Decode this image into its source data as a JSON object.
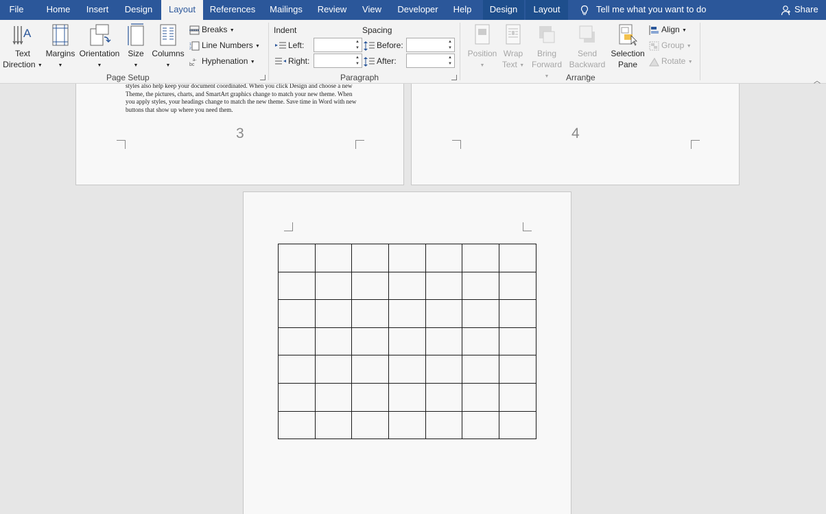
{
  "tabs": [
    {
      "label": "File",
      "active": false
    },
    {
      "label": "Home",
      "active": false
    },
    {
      "label": "Insert",
      "active": false
    },
    {
      "label": "Design",
      "active": false
    },
    {
      "label": "Layout",
      "active": true
    },
    {
      "label": "References",
      "active": false
    },
    {
      "label": "Mailings",
      "active": false
    },
    {
      "label": "Review",
      "active": false
    },
    {
      "label": "View",
      "active": false
    },
    {
      "label": "Developer",
      "active": false
    },
    {
      "label": "Help",
      "active": false
    },
    {
      "label": "Design",
      "active": false,
      "contextual": true
    },
    {
      "label": "Layout",
      "active": false,
      "contextual": true
    }
  ],
  "tell_me": "Tell me what you want to do",
  "share": "Share",
  "page_setup": {
    "text_direction": {
      "line1": "Text",
      "line2": "Direction"
    },
    "margins": "Margins",
    "orientation": "Orientation",
    "size": "Size",
    "columns": "Columns",
    "breaks": "Breaks",
    "line_numbers": "Line Numbers",
    "hyphenation": "Hyphenation",
    "group_label": "Page Setup"
  },
  "paragraph": {
    "indent_label": "Indent",
    "spacing_label": "Spacing",
    "left_label": "Left:",
    "right_label": "Right:",
    "before_label": "Before:",
    "after_label": "After:",
    "left_value": "",
    "right_value": "",
    "before_value": "",
    "after_value": "",
    "group_label": "Paragraph"
  },
  "arrange": {
    "position": "Position",
    "wrap_text": {
      "line1": "Wrap",
      "line2": "Text"
    },
    "bring_forward": {
      "line1": "Bring",
      "line2": "Forward"
    },
    "send_backward": {
      "line1": "Send",
      "line2": "Backward"
    },
    "selection_pane": {
      "line1": "Selection",
      "line2": "Pane"
    },
    "align": "Align",
    "group": "Group",
    "rotate": "Rotate",
    "group_label": "Arrange"
  },
  "document": {
    "page3_text": "Click Insert and then choose the elements you want from the different galleries. Themes and styles also help keep your document coordinated. When you click Design and choose a new Theme, the pictures, charts, and SmartArt graphics change to match your new theme. When you apply styles, your headings change to match the new theme. Save time in Word with new buttons that show up where you need them.",
    "page3_number": "3",
    "page4_number": "4",
    "table_rows": 7,
    "table_cols": 7
  }
}
